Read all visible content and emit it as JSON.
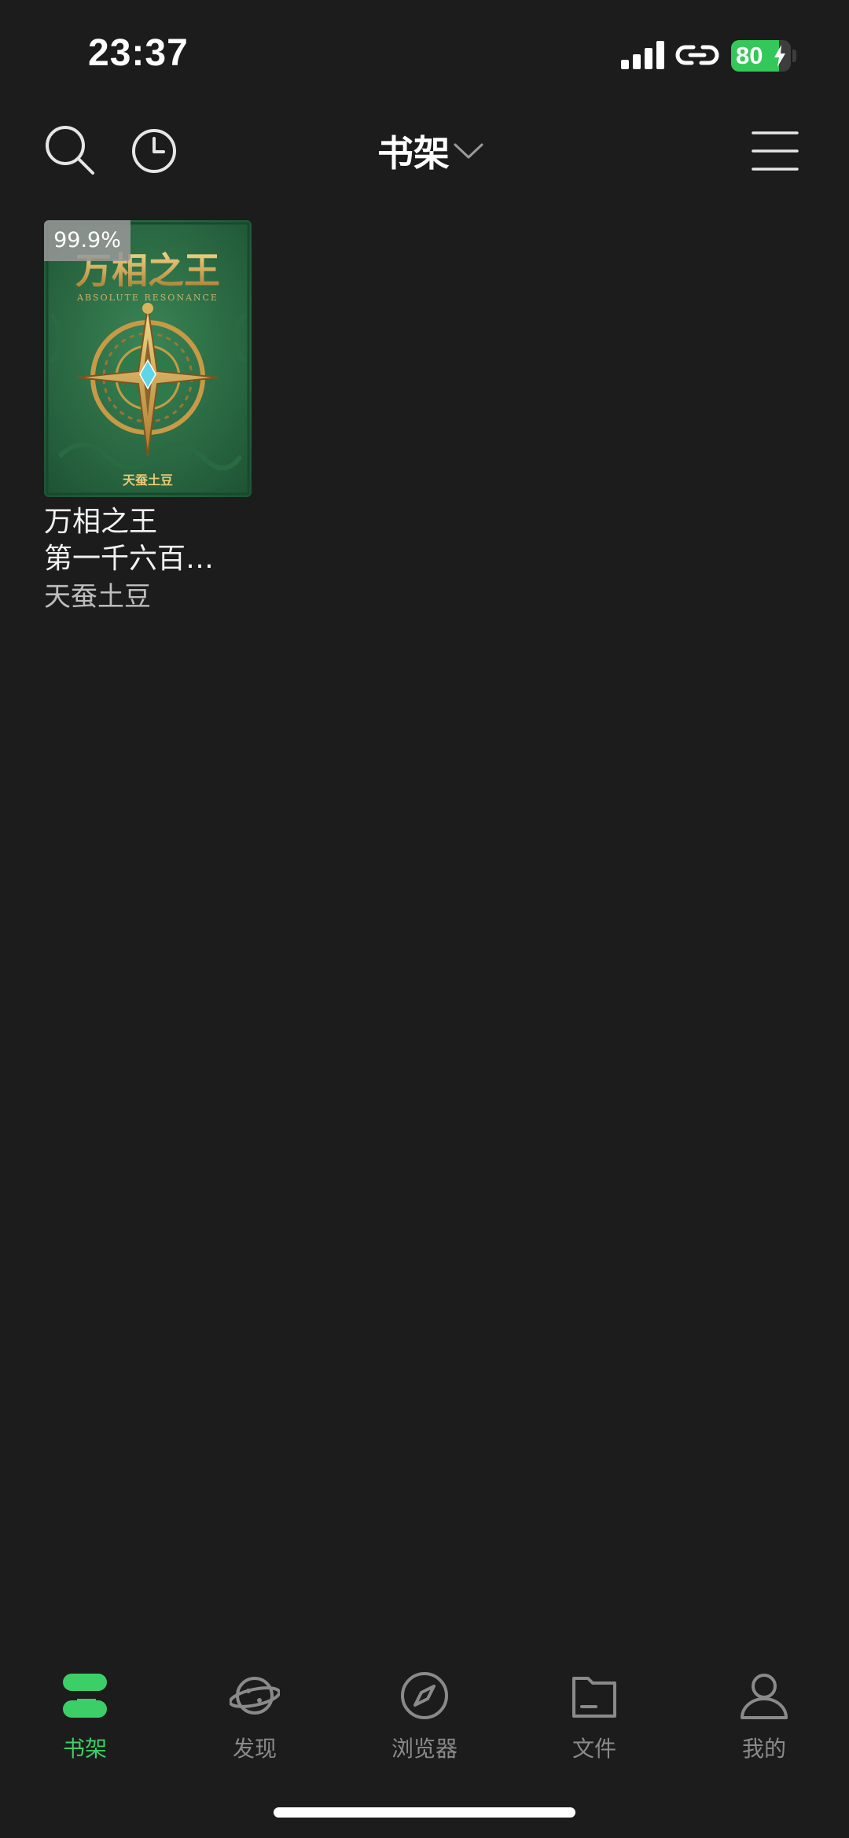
{
  "status_bar": {
    "time": "23:37",
    "battery_level": 80,
    "battery_text": "80",
    "charging": true,
    "battery_color": "#34c759"
  },
  "toolbar": {
    "search_icon": "search-icon",
    "history_icon": "history-clock-icon",
    "title": "书架",
    "title_dropdown_icon": "chevron-down-icon",
    "menu_icon": "hamburger-menu-icon"
  },
  "books": [
    {
      "progress": "99.9%",
      "cover_title": "万相之王",
      "cover_subtitle": "ABSOLUTE RESONANCE",
      "cover_author": "天蚕土豆",
      "title": "万相之王",
      "latest_chapter": "第一千六百…",
      "author": "天蚕土豆"
    }
  ],
  "tabs": [
    {
      "label": "书架",
      "icon": "bookshelf-icon",
      "active": true
    },
    {
      "label": "发现",
      "icon": "planet-icon",
      "active": false
    },
    {
      "label": "浏览器",
      "icon": "compass-icon",
      "active": false
    },
    {
      "label": "文件",
      "icon": "folder-icon",
      "active": false
    },
    {
      "label": "我的",
      "icon": "person-icon",
      "active": false
    }
  ],
  "colors": {
    "background": "#1c1c1c",
    "accent": "#3ccf68",
    "inactive_tab": "#8a8a8a",
    "cover_green": "#2c6b45",
    "cover_gold": "#d9b45a"
  }
}
